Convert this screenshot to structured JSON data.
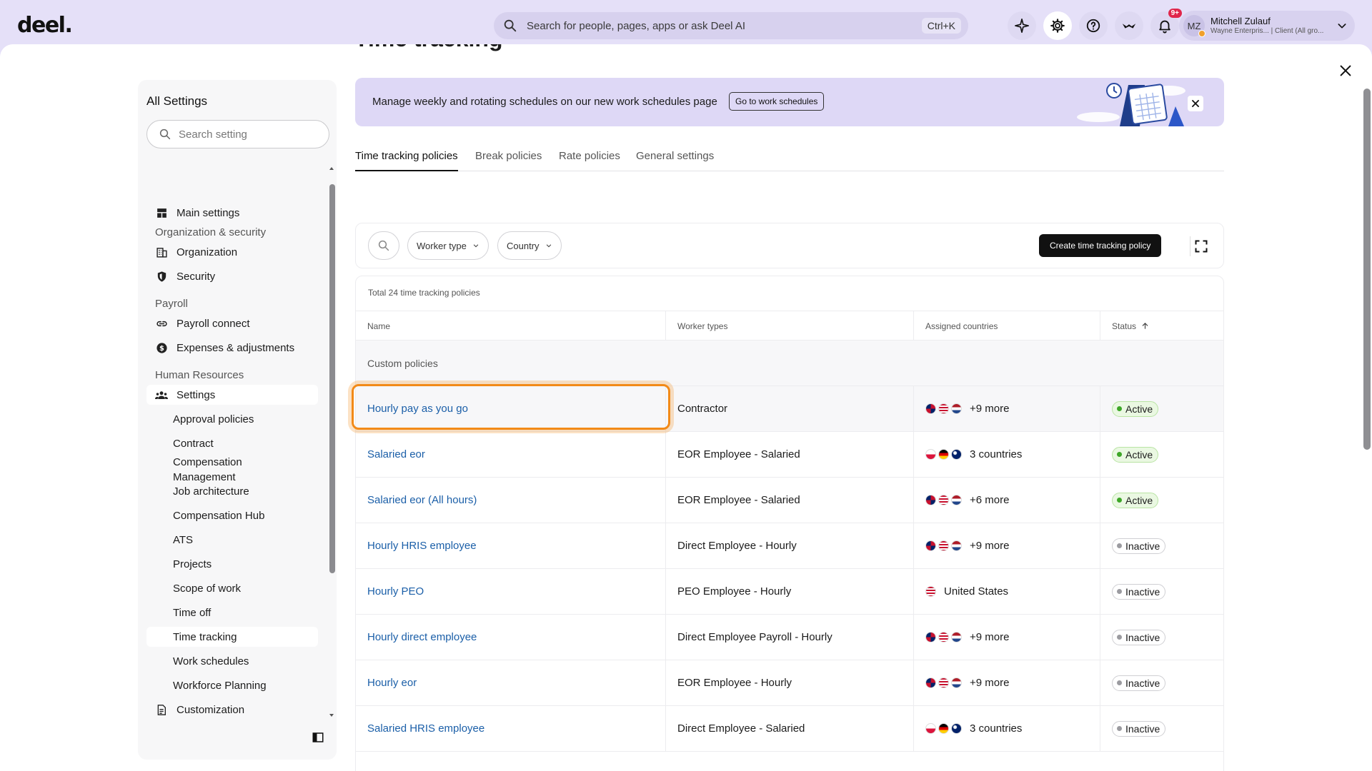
{
  "header": {
    "logo": "deel.",
    "search_placeholder": "Search for people, pages, apps or ask Deel AI",
    "search_shortcut": "Ctrl+K",
    "notifications_badge": "9+",
    "user": {
      "initials": "MZ",
      "name": "Mitchell Zulauf",
      "org": "Wayne Enterpris... | Client (All gro..."
    }
  },
  "page": {
    "title": "Time tracking"
  },
  "sidebar": {
    "title": "All Settings",
    "search_placeholder": "Search setting",
    "main_settings": "Main settings",
    "sections": {
      "org_security": "Organization & security",
      "payroll": "Payroll",
      "hr": "Human Resources"
    },
    "items": {
      "organization": "Organization",
      "security": "Security",
      "payroll_connect": "Payroll connect",
      "expenses": "Expenses & adjustments",
      "settings": "Settings",
      "approval_policies": "Approval policies",
      "contract": "Contract",
      "compensation_management": "Compensation Management",
      "job_architecture": "Job architecture",
      "compensation_hub": "Compensation Hub",
      "ats": "ATS",
      "projects": "Projects",
      "scope_of_work": "Scope of work",
      "time_off": "Time off",
      "time_tracking": "Time tracking",
      "work_schedules": "Work schedules",
      "workforce_planning": "Workforce Planning",
      "customization": "Customization"
    }
  },
  "banner": {
    "text": "Manage weekly and rotating schedules on our new work schedules page",
    "button": "Go to work schedules"
  },
  "tabs": [
    "Time tracking policies",
    "Break policies",
    "Rate policies",
    "General settings"
  ],
  "filters": {
    "worker_type": "Worker type",
    "country": "Country",
    "create_button": "Create time tracking policy"
  },
  "table": {
    "total": "Total 24 time tracking policies",
    "columns": [
      "Name",
      "Worker types",
      "Assigned countries",
      "Status"
    ],
    "group": "Custom policies",
    "rows": [
      {
        "name": "Hourly pay as you go",
        "worker": "Contractor",
        "countries": "+9 more",
        "flags": [
          "gb",
          "us",
          "nl"
        ],
        "status": "Active"
      },
      {
        "name": "Salaried eor",
        "worker": "EOR Employee - Salaried",
        "countries": "3 countries",
        "flags": [
          "pl",
          "de",
          "au"
        ],
        "status": "Active"
      },
      {
        "name": "Salaried eor (All hours)",
        "worker": "EOR Employee - Salaried",
        "countries": "+6 more",
        "flags": [
          "gb",
          "us",
          "nl"
        ],
        "status": "Active"
      },
      {
        "name": "Hourly HRIS employee",
        "worker": "Direct Employee - Hourly",
        "countries": "+9 more",
        "flags": [
          "gb",
          "us",
          "nl"
        ],
        "status": "Inactive"
      },
      {
        "name": "Hourly PEO",
        "worker": "PEO Employee - Hourly",
        "countries": "United States",
        "flags": [
          "us"
        ],
        "status": "Inactive"
      },
      {
        "name": "Hourly direct employee",
        "worker": "Direct Employee Payroll - Hourly",
        "countries": "+9 more",
        "flags": [
          "gb",
          "us",
          "nl"
        ],
        "status": "Inactive"
      },
      {
        "name": "Hourly eor",
        "worker": "EOR Employee - Hourly",
        "countries": "+9 more",
        "flags": [
          "gb",
          "us",
          "nl"
        ],
        "status": "Inactive"
      },
      {
        "name": "Salaried HRIS employee",
        "worker": "Direct Employee - Salaried",
        "countries": "3 countries",
        "flags": [
          "pl",
          "de",
          "au"
        ],
        "status": "Inactive"
      }
    ]
  },
  "colors": {
    "brand_bg": "#e5e0f8",
    "link": "#1b5fa8",
    "highlight": "#f28a18",
    "active_green": "#3da627"
  }
}
